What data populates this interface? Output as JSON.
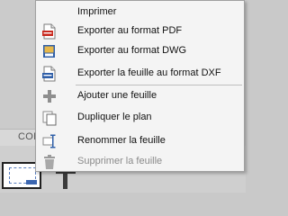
{
  "background": {
    "tab_label": "CON"
  },
  "menu": {
    "items": [
      {
        "label": "Imprimer",
        "icon": "print-icon",
        "enabled": true
      },
      {
        "label": "Exporter au format PDF",
        "icon": "pdf-file-icon",
        "enabled": true
      },
      {
        "label": "Exporter au format DWG",
        "icon": "dwg-file-icon",
        "enabled": true
      },
      {
        "label": "Exporter la feuille au format DXF",
        "icon": "dxf-file-icon",
        "enabled": true
      },
      {
        "label": "Ajouter une feuille",
        "icon": "plus-icon",
        "enabled": true
      },
      {
        "label": "Dupliquer le plan",
        "icon": "duplicate-icon",
        "enabled": true
      },
      {
        "label": "Renommer la feuille",
        "icon": "rename-icon",
        "enabled": true
      },
      {
        "label": "Supprimer la feuille",
        "icon": "trash-icon",
        "enabled": false
      }
    ]
  },
  "colors": {
    "menu_background": "#f4f4f4",
    "menu_border": "#a0a0a0",
    "text": "#111111",
    "disabled_text": "#8a8a8a",
    "pdf_red": "#c8281e",
    "dwg_blue": "#2f5fa8",
    "folder_yellow": "#e8b84a"
  }
}
